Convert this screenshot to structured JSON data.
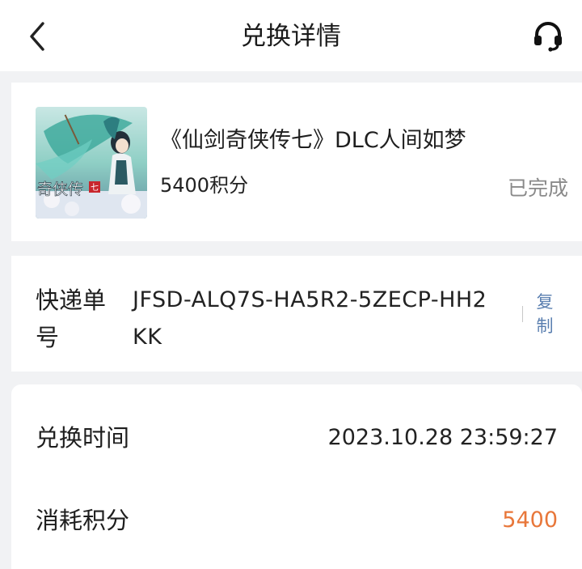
{
  "header": {
    "title": "兑换详情",
    "back_icon": "chevron-left-icon",
    "support_icon": "headset-icon"
  },
  "product": {
    "name": "《仙剑奇侠传七》DLC人间如梦",
    "price": "5400积分",
    "status": "已完成",
    "thumbnail_caption": "奇侠传"
  },
  "tracking": {
    "label": "快递单号",
    "value": "JFSD-ALQ7S-HA5R2-5ZECP-HH2KK",
    "copy_label": "复制"
  },
  "details": {
    "exchange_time_label": "兑换时间",
    "exchange_time_value": "2023.10.28 23:59:27",
    "points_label": "消耗积分",
    "points_value": "5400"
  },
  "colors": {
    "accent": "#e8773a",
    "link": "#5a7fb0",
    "muted": "#8a8a8a",
    "background": "#f1f2f4"
  }
}
